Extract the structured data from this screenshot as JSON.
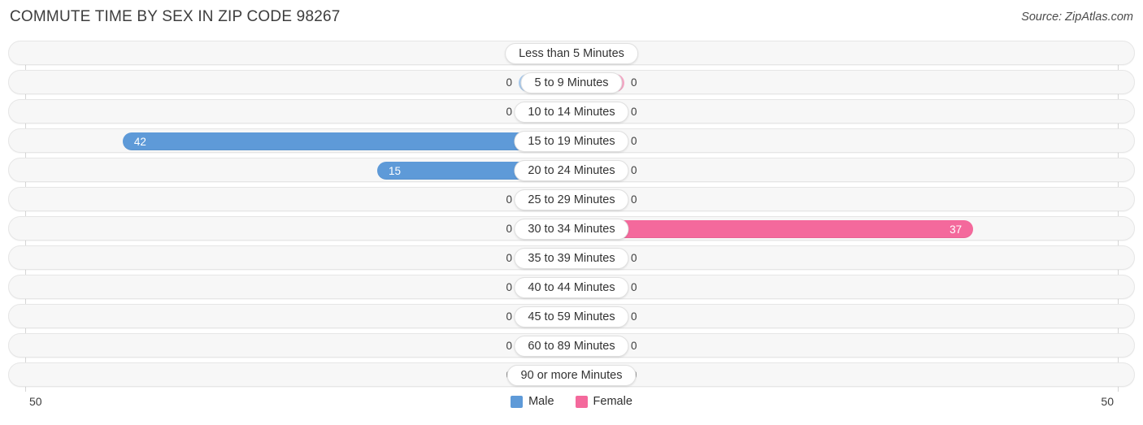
{
  "header": {
    "title": "COMMUTE TIME BY SEX IN ZIP CODE 98267",
    "source": "Source: ZipAtlas.com"
  },
  "legend": {
    "male_label": "Male",
    "female_label": "Female",
    "male_color": "#5e9ad8",
    "female_color": "#f4699c",
    "male_color_muted": "#a9caec",
    "female_color_muted": "#f5a7c5"
  },
  "axis": {
    "left_tick": "50",
    "right_tick": "50",
    "max": 50
  },
  "chart_data": {
    "type": "bar",
    "title": "COMMUTE TIME BY SEX IN ZIP CODE 98267",
    "xlabel": "",
    "ylabel": "",
    "orientation": "horizontal-diverging",
    "xlim": [
      -50,
      50
    ],
    "grid": false,
    "legend_position": "bottom-center",
    "categories": [
      "Less than 5 Minutes",
      "5 to 9 Minutes",
      "10 to 14 Minutes",
      "15 to 19 Minutes",
      "20 to 24 Minutes",
      "25 to 29 Minutes",
      "30 to 34 Minutes",
      "35 to 39 Minutes",
      "40 to 44 Minutes",
      "45 to 59 Minutes",
      "60 to 89 Minutes",
      "90 or more Minutes"
    ],
    "series": [
      {
        "name": "Male",
        "values": [
          0,
          0,
          0,
          42,
          15,
          0,
          0,
          0,
          0,
          0,
          0,
          0
        ]
      },
      {
        "name": "Female",
        "values": [
          0,
          0,
          0,
          0,
          0,
          0,
          37,
          0,
          0,
          0,
          0,
          0
        ]
      }
    ]
  },
  "rows": [
    {
      "label": "Less than 5 Minutes",
      "male": "0",
      "female": "0"
    },
    {
      "label": "5 to 9 Minutes",
      "male": "0",
      "female": "0"
    },
    {
      "label": "10 to 14 Minutes",
      "male": "0",
      "female": "0"
    },
    {
      "label": "15 to 19 Minutes",
      "male": "42",
      "female": "0"
    },
    {
      "label": "20 to 24 Minutes",
      "male": "15",
      "female": "0"
    },
    {
      "label": "25 to 29 Minutes",
      "male": "0",
      "female": "0"
    },
    {
      "label": "30 to 34 Minutes",
      "male": "0",
      "female": "37"
    },
    {
      "label": "35 to 39 Minutes",
      "male": "0",
      "female": "0"
    },
    {
      "label": "40 to 44 Minutes",
      "male": "0",
      "female": "0"
    },
    {
      "label": "45 to 59 Minutes",
      "male": "0",
      "female": "0"
    },
    {
      "label": "60 to 89 Minutes",
      "male": "0",
      "female": "0"
    },
    {
      "label": "90 or more Minutes",
      "male": "0",
      "female": "0"
    }
  ]
}
